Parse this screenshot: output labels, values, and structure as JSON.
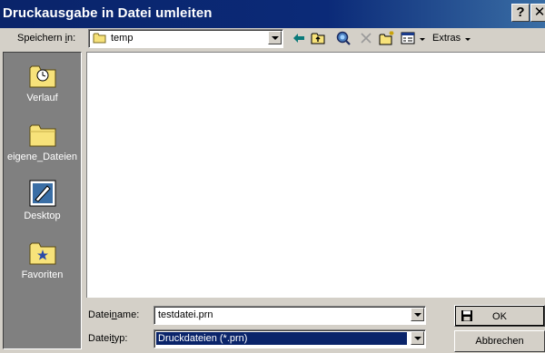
{
  "window": {
    "title": "Druckausgabe in Datei umleiten",
    "help_glyph": "?",
    "close_glyph": "✕"
  },
  "toolbar": {
    "lookin_label_pre": "Speichern ",
    "lookin_label_u": "i",
    "lookin_label_post": "n:",
    "lookin_value": "temp",
    "extras_label": "Extras",
    "icons": [
      "back-icon",
      "up-folder-icon",
      "search-web-icon",
      "delete-icon",
      "new-folder-icon",
      "views-icon"
    ]
  },
  "places": [
    {
      "label": "Verlauf",
      "icon": "history-folder-icon"
    },
    {
      "label": "eigene_Dateien",
      "icon": "my-documents-icon"
    },
    {
      "label": "Desktop",
      "icon": "desktop-icon"
    },
    {
      "label": "Favoriten",
      "icon": "favorites-icon"
    }
  ],
  "filename": {
    "label_pre": "Datei",
    "label_u": "n",
    "label_post": "ame:",
    "value": "testdatei.prn"
  },
  "filetype": {
    "label_pre": "Datei",
    "label_u": "t",
    "label_post": "yp:",
    "value": "Druckdateien (*.prn)"
  },
  "buttons": {
    "ok": "OK",
    "cancel": "Abbrechen"
  },
  "colors": {
    "titlebar": "#0a246a",
    "face": "#d4d0c8",
    "places_bg": "#808080",
    "selection": "#0a246a",
    "folder": "#f7e27a"
  }
}
